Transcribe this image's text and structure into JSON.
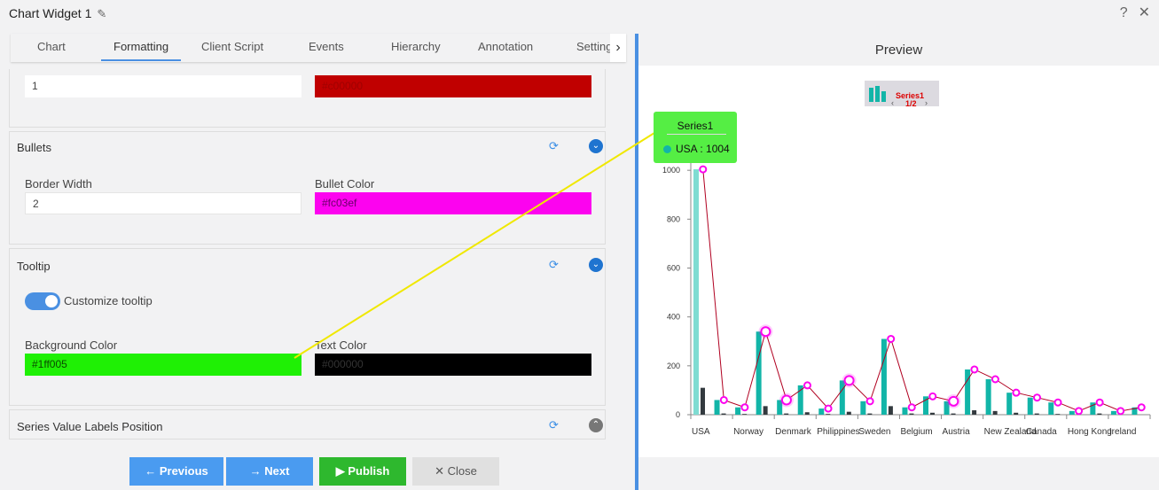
{
  "window": {
    "title": "Chart Widget 1",
    "edit_icon": "pencil-icon",
    "help": "?",
    "close": "✕"
  },
  "tabs": [
    "Chart",
    "Formatting",
    "Client Script",
    "Events",
    "Hierarchy",
    "Annotation",
    "Settings"
  ],
  "active_tab": "Formatting",
  "top_row": {
    "value": "1",
    "color": "#c00000",
    "color_hex": "#c00000"
  },
  "bullets": {
    "title": "Bullets",
    "border_width_label": "Border Width",
    "border_width": "2",
    "bullet_color_label": "Bullet Color",
    "bullet_color": "#fc03ef"
  },
  "tooltip": {
    "title": "Tooltip",
    "customize_label": "Customize tooltip",
    "customize_on": true,
    "bg_label": "Background Color",
    "bg_color": "#1ff005",
    "text_label": "Text Color",
    "text_color": "#000000"
  },
  "series_labels": {
    "title": "Series Value Labels Position"
  },
  "footer": {
    "previous": "Previous",
    "next": "Next",
    "publish": "Publish",
    "close": "Close"
  },
  "preview": {
    "title": "Preview",
    "legend_series": "Series1",
    "legend_page": "1/2",
    "tooltip_title": "Series1",
    "tooltip_text": "USA : 1004"
  },
  "chart_data": {
    "type": "bar",
    "categories": [
      "USA",
      "Norway",
      "Denmark",
      "Philippines",
      "Sweden",
      "Belgium",
      "Austria",
      "New Zealand",
      "Canada",
      "Hong Kong",
      "Ireland"
    ],
    "ylim": [
      0,
      1200
    ],
    "yticks": [
      0,
      200,
      400,
      600,
      800,
      1000,
      1200
    ],
    "series": [
      {
        "name": "Series1",
        "type": "bar",
        "color": "#12b5a8",
        "values": [
          1004,
          60,
          30,
          340,
          60,
          120,
          25,
          140,
          55,
          310,
          30,
          75,
          55,
          185,
          145,
          90,
          70,
          50,
          15,
          50,
          15,
          30
        ]
      },
      {
        "type": "bar",
        "color": "#333a3f",
        "values": [
          110,
          5,
          3,
          35,
          5,
          10,
          3,
          12,
          5,
          35,
          5,
          8,
          5,
          18,
          15,
          8,
          5,
          3,
          1,
          5,
          0,
          0
        ]
      },
      {
        "type": "line",
        "color": "#b00020",
        "marker_color": "#fc03ef",
        "values": [
          1004,
          60,
          30,
          340,
          60,
          120,
          25,
          140,
          55,
          310,
          30,
          75,
          55,
          185,
          145,
          90,
          70,
          50,
          15,
          50,
          15,
          30
        ]
      }
    ]
  }
}
